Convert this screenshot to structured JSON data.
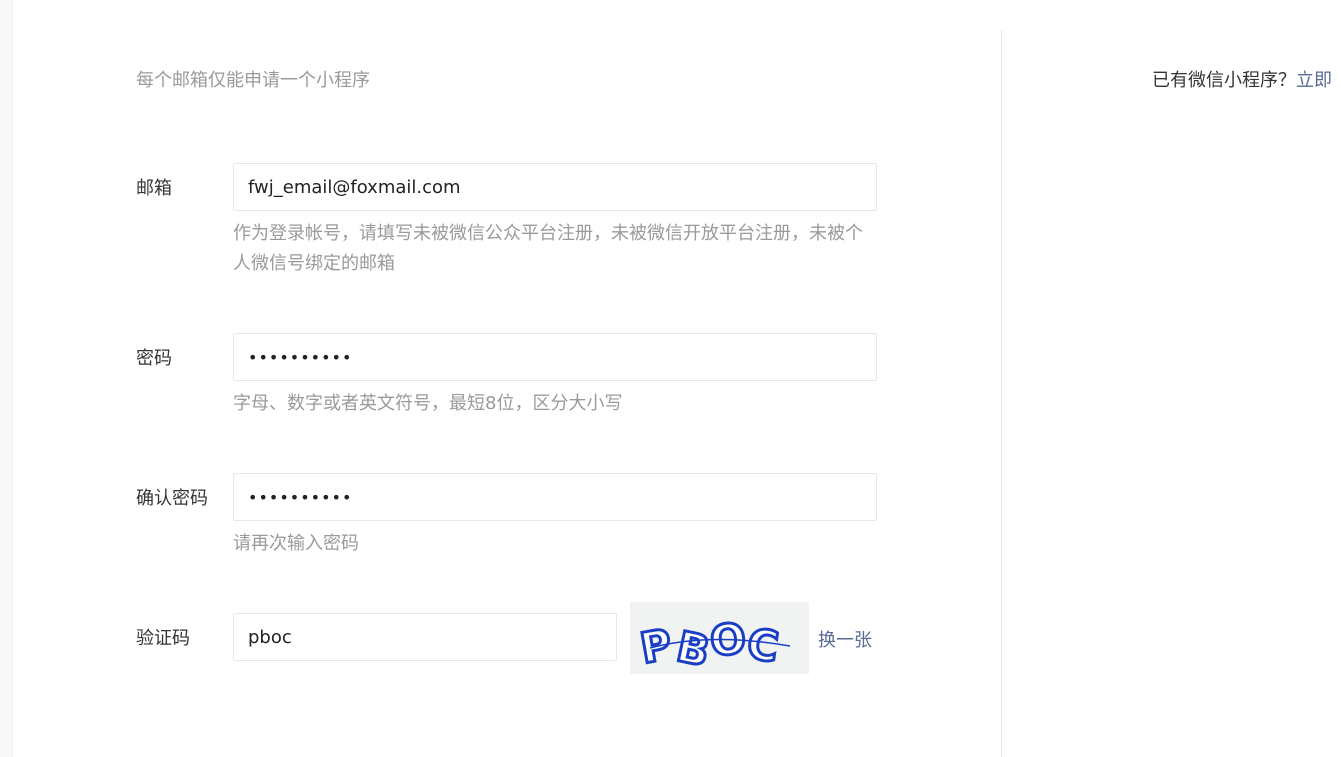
{
  "header": {
    "notice": "每个邮箱仅能申请一个小程序",
    "has_app_text": "已有微信小程序？",
    "has_app_link": "立即"
  },
  "form": {
    "email": {
      "label": "邮箱",
      "value": "fwj_email@foxmail.com",
      "hint": "作为登录帐号，请填写未被微信公众平台注册，未被微信开放平台注册，未被个人微信号绑定的邮箱"
    },
    "password": {
      "label": "密码",
      "value": "••••••••••",
      "hint": "字母、数字或者英文符号，最短8位，区分大小写"
    },
    "confirm": {
      "label": "确认密码",
      "value": "••••••••••",
      "hint": "请再次输入密码"
    },
    "captcha": {
      "label": "验证码",
      "value": "pboc",
      "image_text": "PBOC",
      "refresh_label": "换一张"
    }
  },
  "colors": {
    "link": "#576b95",
    "captcha_ink": "#1a3fc4"
  }
}
